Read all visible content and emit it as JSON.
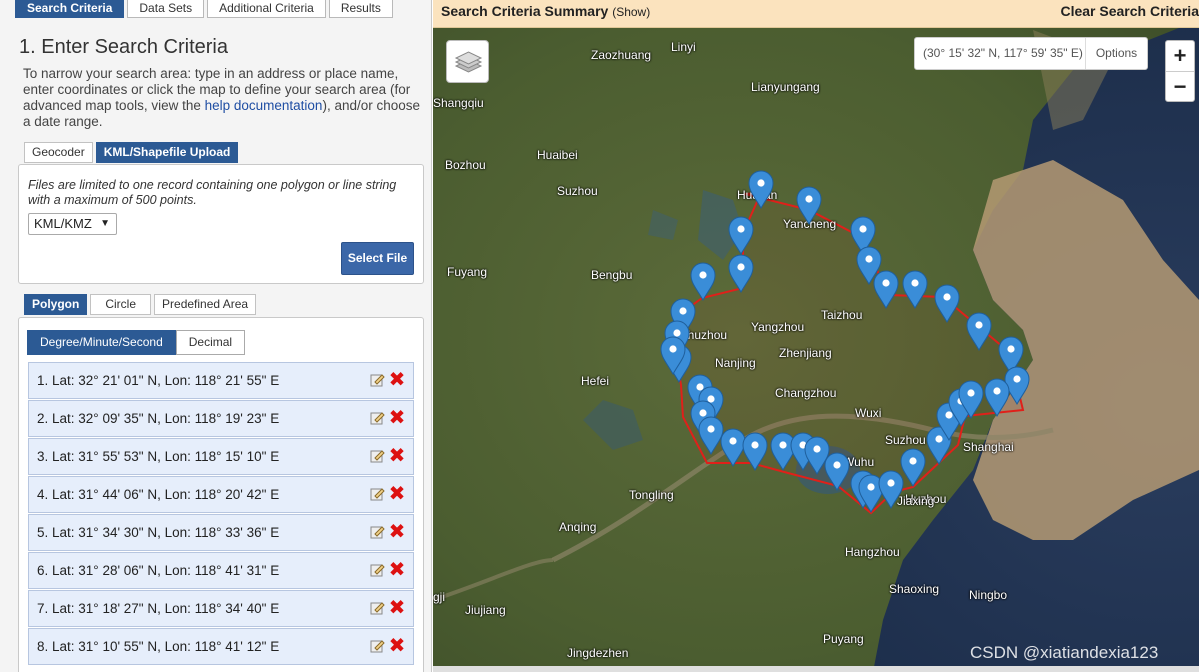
{
  "tabs": [
    "Search Criteria",
    "Data Sets",
    "Additional Criteria",
    "Results"
  ],
  "heading": "1. Enter Search Criteria",
  "intro": {
    "before": "To narrow your search area: type in an address or place name, enter coordinates or click the map to define your search area (for advanced map tools, view the ",
    "link": "help documentation",
    "after": "), and/or choose a date range."
  },
  "input_tabs": [
    "Geocoder",
    "KML/Shapefile Upload"
  ],
  "upload": {
    "note": "Files are limited to one record containing one polygon or line string with a maximum of 500 points.",
    "format": "KML/KMZ",
    "select_button": "Select File"
  },
  "shape_tabs": [
    "Polygon",
    "Circle",
    "Predefined Area"
  ],
  "coord_format": [
    "Degree/Minute/Second",
    "Decimal"
  ],
  "points": [
    "1.  Lat: 32° 21' 01\" N, Lon: 118° 21' 55\" E",
    "2.  Lat: 32° 09' 35\" N, Lon: 118° 19' 23\" E",
    "3.  Lat: 31° 55' 53\" N, Lon: 118° 15' 10\" E",
    "4.  Lat: 31° 44' 06\" N, Lon: 118° 20' 42\" E",
    "5.  Lat: 31° 34' 30\" N, Lon: 118° 33' 36\" E",
    "6.  Lat: 31° 28' 06\" N, Lon: 118° 41' 31\" E",
    "7.  Lat: 31° 18' 27\" N, Lon: 118° 34' 40\" E",
    "8.  Lat: 31° 10' 55\" N, Lon: 118° 41' 12\" E"
  ],
  "summary_bar": {
    "title": "Search Criteria Summary",
    "show": "(Show)",
    "clear": "Clear Search Criteria"
  },
  "map": {
    "cursor_coord": "(30° 15' 32\" N, 117° 59' 35\" E)",
    "options": "Options",
    "zoom_in": "+",
    "zoom_out": "−",
    "cities": [
      "Zaozhuang",
      "Linyi",
      "Lianyungang",
      "Shangqiu",
      "Bozhou",
      "Huaibei",
      "Suzhou",
      "Huai'an",
      "Yancheng",
      "Fuyang",
      "Bengbu",
      "Yangzhou",
      "Taizhou",
      "Chuzhou",
      "Nanjing",
      "Zhenjiang",
      "Hefei",
      "Changzhou",
      "Wuxi",
      "Suzhou",
      "Shanghai",
      "Wuhu",
      "Huzhou",
      "Jiaxing",
      "Tongling",
      "Anqing",
      "Hangzhou",
      "Shaoxing",
      "Ningbo",
      "Jiujiang",
      "Puyang",
      "Jingdezhen",
      "gji"
    ],
    "watermark": "CSDN @xiatiandexia123",
    "pin_color": "#3a8dd8",
    "polygon_color": "#e0201a"
  }
}
